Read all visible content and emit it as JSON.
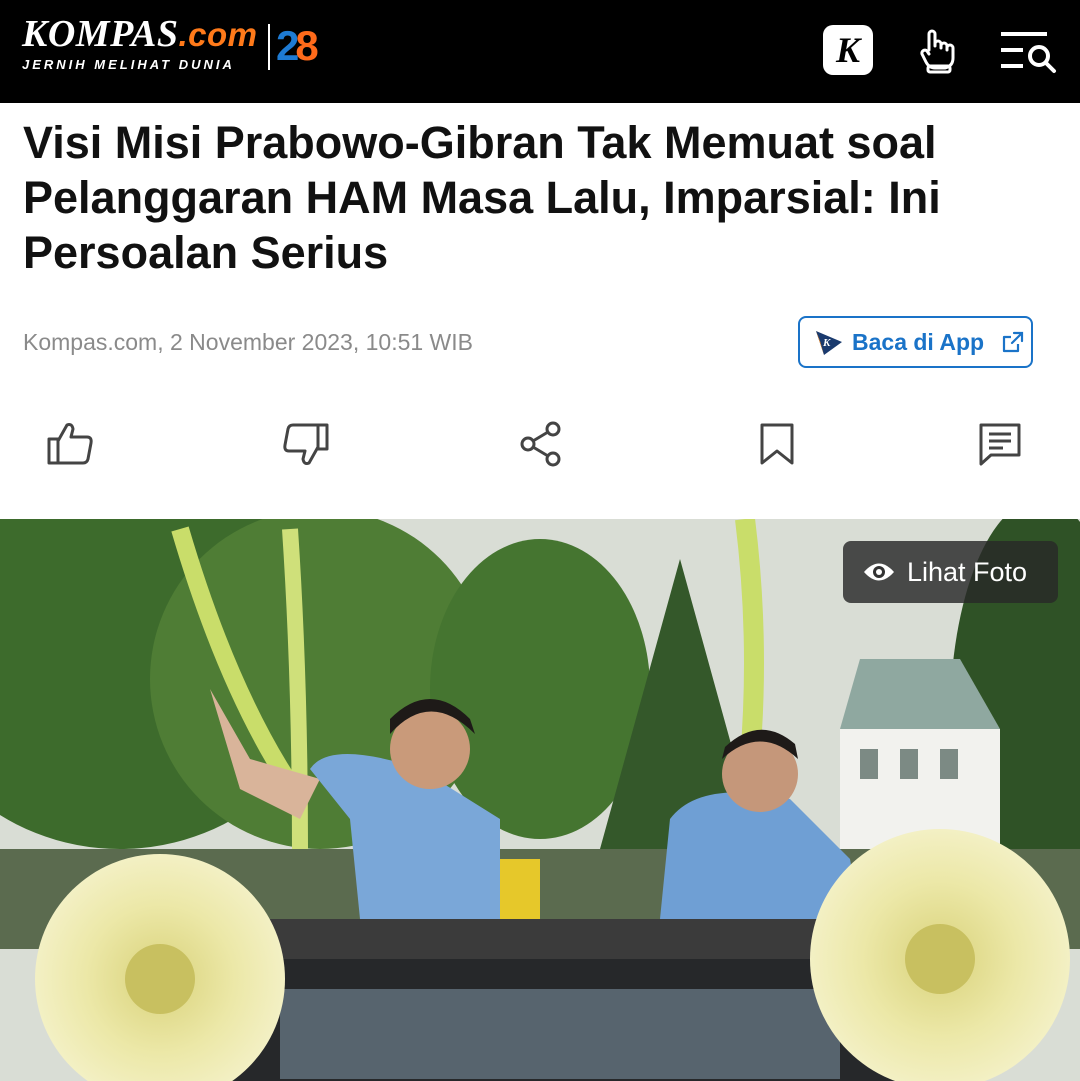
{
  "header": {
    "logo_main": "KOMPAS",
    "logo_dotcom": ".com",
    "logo_tagline": "JERNIH MELIHAT DUNIA",
    "anniversary": "28",
    "k_icon_letter": "K",
    "icons": [
      "kompas-k-icon",
      "hand-icon",
      "search-menu-icon"
    ]
  },
  "article": {
    "title": "Visi Misi Prabowo-Gibran Tak Memuat soal Pelanggaran HAM Masa Lalu, Imparsial: Ini Persoalan Serius",
    "meta": "Kompas.com, 2 November 2023, 10:51 WIB",
    "app_button_label": "Baca di App"
  },
  "actions": [
    "like-icon",
    "dislike-icon",
    "share-icon",
    "bookmark-icon",
    "comment-icon"
  ],
  "photo": {
    "view_button_label": "Lihat Foto"
  },
  "colors": {
    "header_bg": "#000000",
    "accent_blue": "#1a73c8",
    "logo_orange": "#ff7a1a"
  }
}
